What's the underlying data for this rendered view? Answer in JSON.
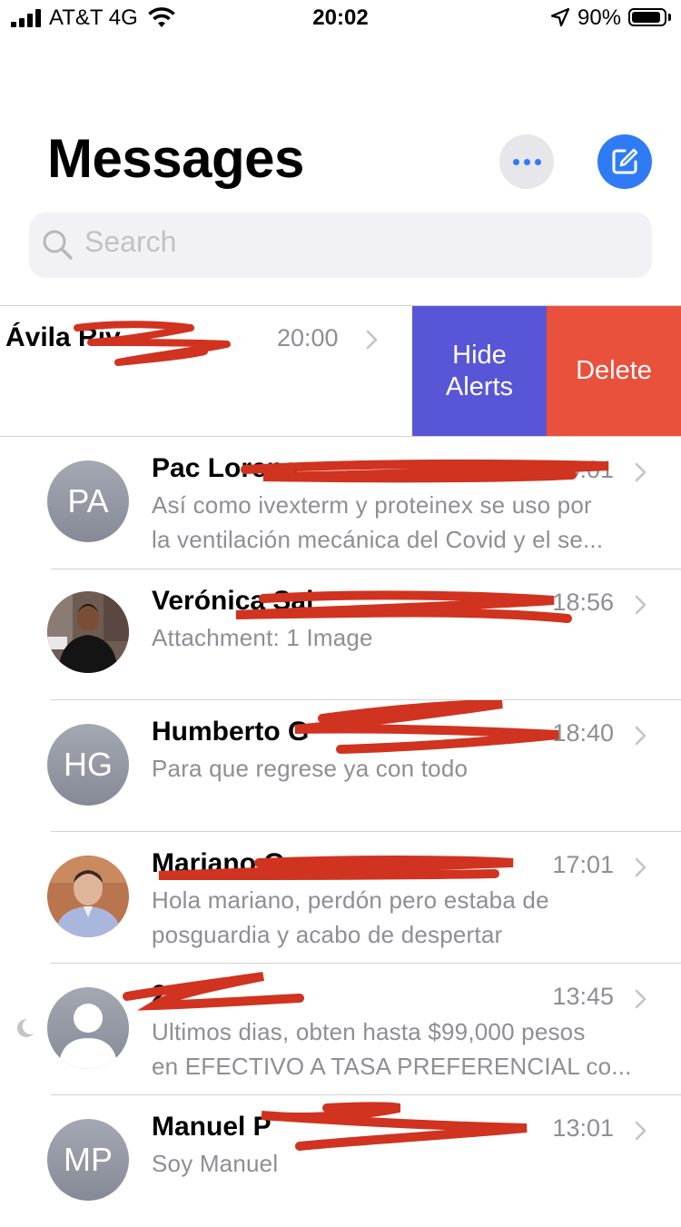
{
  "status_bar": {
    "carrier": "AT&T 4G",
    "time": "20:02",
    "battery_percent": "90%",
    "battery_level": 0.9,
    "icons": [
      "signal-icon",
      "wifi-icon",
      "location-arrow-icon",
      "battery-icon"
    ]
  },
  "header": {
    "title": "Messages",
    "icons": [
      "more-icon",
      "compose-icon"
    ]
  },
  "search": {
    "placeholder": "Search",
    "icon": "search-icon"
  },
  "swiped_row": {
    "name": "Ávila Riv",
    "time": "20:00",
    "actions": {
      "hide_alerts": "Hide\nAlerts",
      "delete": "Delete"
    }
  },
  "conversations": [
    {
      "initials": "PA",
      "name": "Pac Lorena",
      "time": "20:01",
      "preview": "Así como ivexterm y proteinex se uso por\nla ventilación mecánica del Covid  y el se..."
    },
    {
      "name": "Verónica Sal",
      "time": "18:56",
      "preview": "Attachment: 1 Image"
    },
    {
      "initials": "HG",
      "name": "Humberto G",
      "time": "18:40",
      "preview": "Para que regrese ya con todo"
    },
    {
      "name": "Mariano Go",
      "time": "17:01",
      "preview": "Hola mariano, perdón pero estaba de\nposguardia y acabo de despertar"
    },
    {
      "name": "2",
      "time": "13:45",
      "preview": "Ultimos dias, obten hasta $99,000 pesos\nen EFECTIVO A TASA PREFERENCIAL co...",
      "muted": true
    },
    {
      "initials": "MP",
      "name": "Manuel P",
      "time": "13:01",
      "preview": "Soy Manuel"
    }
  ],
  "colors": {
    "accent": "#2f7bf5",
    "hide_alerts": "#5856d6",
    "delete": "#e9513d",
    "redaction": "#d0331f",
    "secondary_text": "#8e8e93"
  }
}
